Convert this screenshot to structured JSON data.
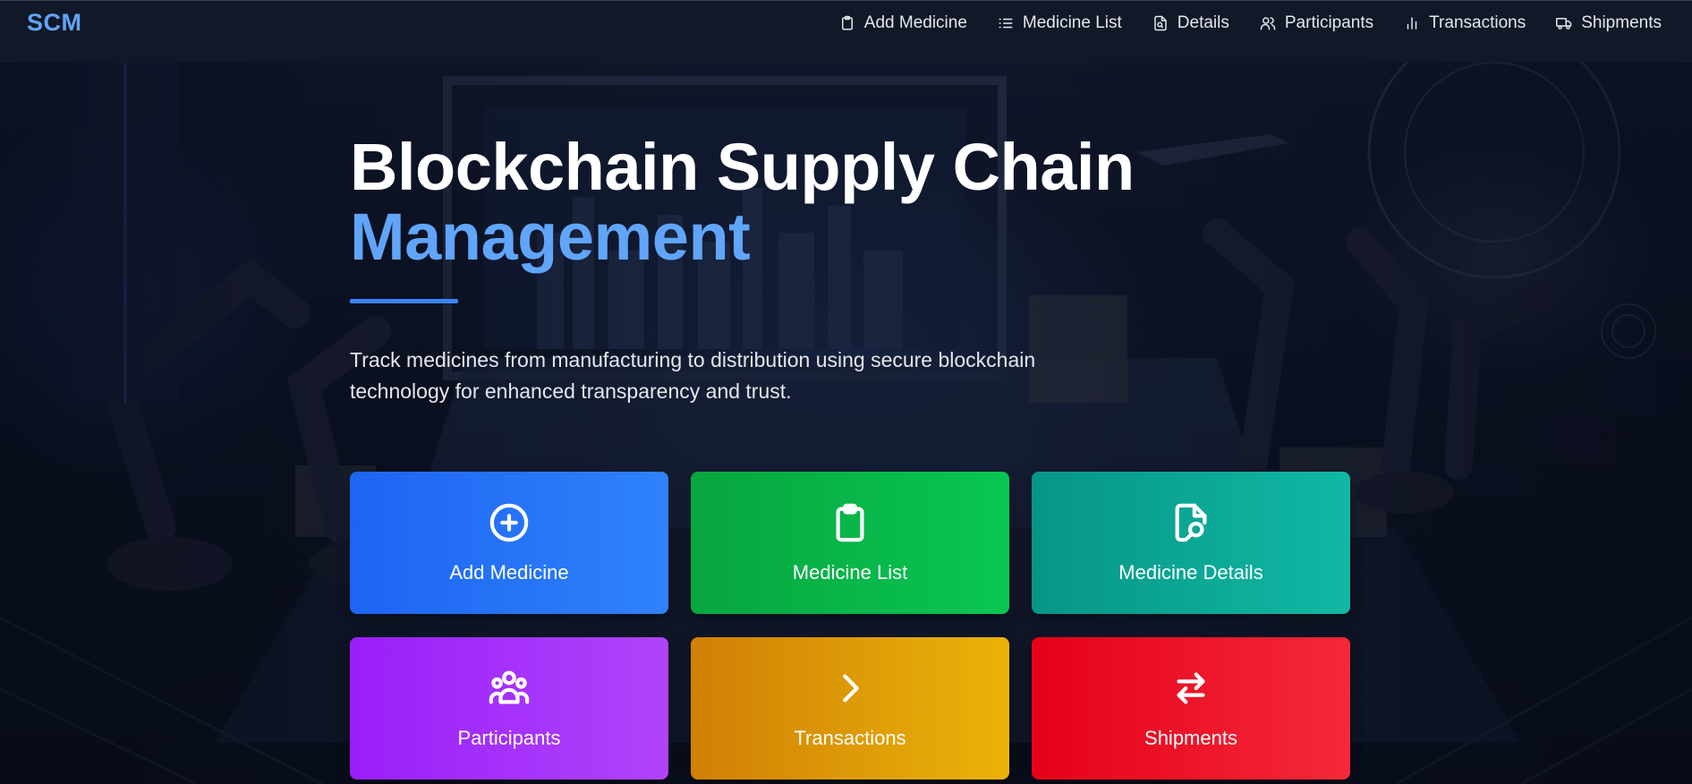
{
  "nav": {
    "brand": "SCM",
    "items": [
      {
        "label": "Add Medicine",
        "icon": "clipboard-icon"
      },
      {
        "label": "Medicine List",
        "icon": "list-icon"
      },
      {
        "label": "Details",
        "icon": "file-search-icon"
      },
      {
        "label": "Participants",
        "icon": "users-icon"
      },
      {
        "label": "Transactions",
        "icon": "bar-chart-icon"
      },
      {
        "label": "Shipments",
        "icon": "truck-icon"
      }
    ]
  },
  "hero": {
    "title_line1": "Blockchain Supply Chain",
    "title_line2": "Management",
    "subtitle": "Track medicines from manufacturing to distribution using secure blockchain technology for enhanced transparency and trust."
  },
  "cards": [
    {
      "label": "Add Medicine",
      "icon": "plus-circle-icon",
      "color": "#2563eb"
    },
    {
      "label": "Medicine List",
      "icon": "clipboard-icon",
      "color": "#16a34a"
    },
    {
      "label": "Medicine Details",
      "icon": "file-search-icon",
      "color": "#0d9488"
    },
    {
      "label": "Participants",
      "icon": "users-icon",
      "color": "#a333fa"
    },
    {
      "label": "Transactions",
      "icon": "chevron-right-icon",
      "color": "#e0a008"
    },
    {
      "label": "Shipments",
      "icon": "arrows-exchange-icon",
      "color": "#ee1c2e"
    }
  ],
  "colors": {
    "accent": "#60a5fa",
    "navbar_bg": "#111827",
    "underline": "#3b82f6"
  }
}
